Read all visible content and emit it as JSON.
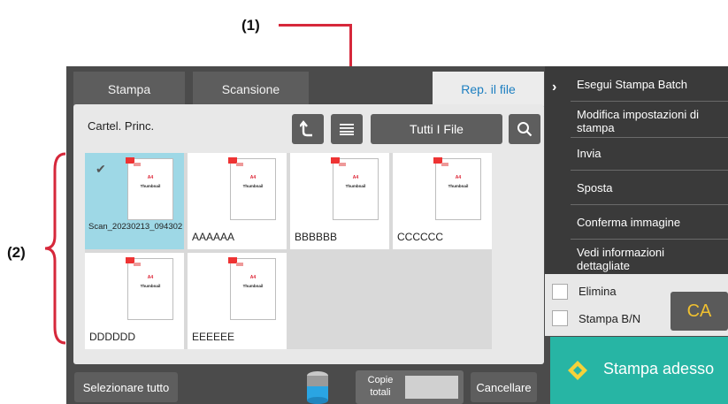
{
  "callouts": {
    "c1": "(1)",
    "c2": "(2)"
  },
  "tabs": {
    "print": "Stampa",
    "scan": "Scansione",
    "file_folder": "Rep. il file"
  },
  "breadcrumb": "Cartel. Princ.",
  "toolbar": {
    "filter_label": "Tutti I File"
  },
  "files": [
    {
      "name": "Scan_20230213_094302",
      "selected": true
    },
    {
      "name": "AAAAAA",
      "selected": false
    },
    {
      "name": "BBBBBB",
      "selected": false
    },
    {
      "name": "CCCCCC",
      "selected": false
    },
    {
      "name": "DDDDDD",
      "selected": false
    },
    {
      "name": "EEEEEE",
      "selected": false
    }
  ],
  "thumb": {
    "size": "A4",
    "caption": "Thumbnail"
  },
  "menu": {
    "items": [
      "Esegui Stampa Batch",
      "Modifica impostazioni di stampa",
      "Invia",
      "Sposta",
      "Conferma immagine",
      "Vedi informazioni dettagliate"
    ]
  },
  "options": {
    "delete": "Elimina",
    "bw_print": "Stampa B/N"
  },
  "ca_label": "CA",
  "print_now": "Stampa adesso",
  "bottom": {
    "select_all": "Selezionare tutto",
    "copies_label": "Copie totali",
    "cancel": "Cancellare"
  },
  "colors": {
    "accent_teal": "#27b5a4",
    "callout_red": "#d6283b",
    "tab_active_text": "#1d7fc1",
    "selected_file": "#9ed8e6"
  }
}
